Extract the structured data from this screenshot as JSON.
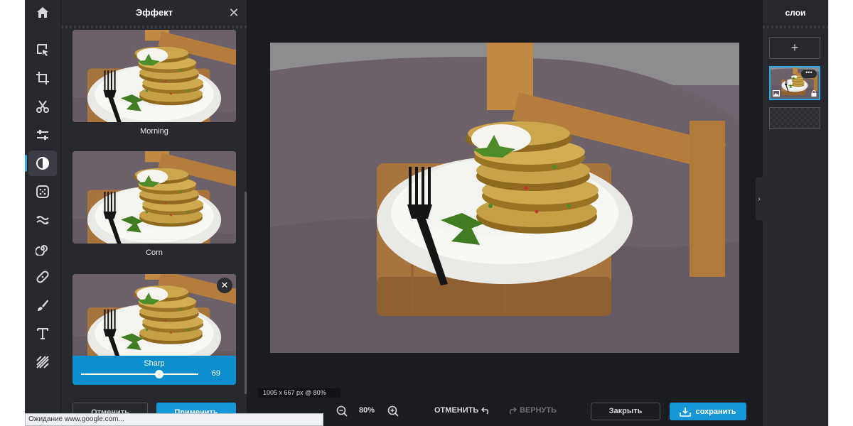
{
  "effect_panel": {
    "title": "Эффект",
    "effects": [
      {
        "label": "Morning"
      },
      {
        "label": "Corn"
      },
      {
        "label": "Sharp",
        "strength": 69
      }
    ],
    "cancel_label": "Отменить",
    "apply_label": "Применить"
  },
  "canvas": {
    "dimensions": "1005 x 667 px @ 80%"
  },
  "bottom_bar": {
    "zoom": "80%",
    "undo_label": "ОТМЕНИТЬ",
    "redo_label": "ВЕРНУТЬ",
    "close_label": "Закрыть",
    "save_label": "сохранить"
  },
  "layers_panel": {
    "title": "слои",
    "add_label": "+"
  },
  "browser_status": "Ожидание www.google.com...",
  "colors": {
    "accent": "#1597d8",
    "panel": "#28292e",
    "background": "#1b1c20"
  },
  "icons": [
    "home-icon",
    "select-icon",
    "crop-icon",
    "cut-icon",
    "adjust-icon",
    "effect-icon",
    "filter-icon",
    "liquify-icon",
    "spiral-icon",
    "heal-icon",
    "brush-icon",
    "text-icon",
    "pattern-icon",
    "close-icon",
    "zoom-out-icon",
    "zoom-in-icon",
    "undo-icon",
    "redo-icon",
    "download-icon",
    "chevron-right-icon",
    "more-icon",
    "lock-icon",
    "image-icon"
  ]
}
